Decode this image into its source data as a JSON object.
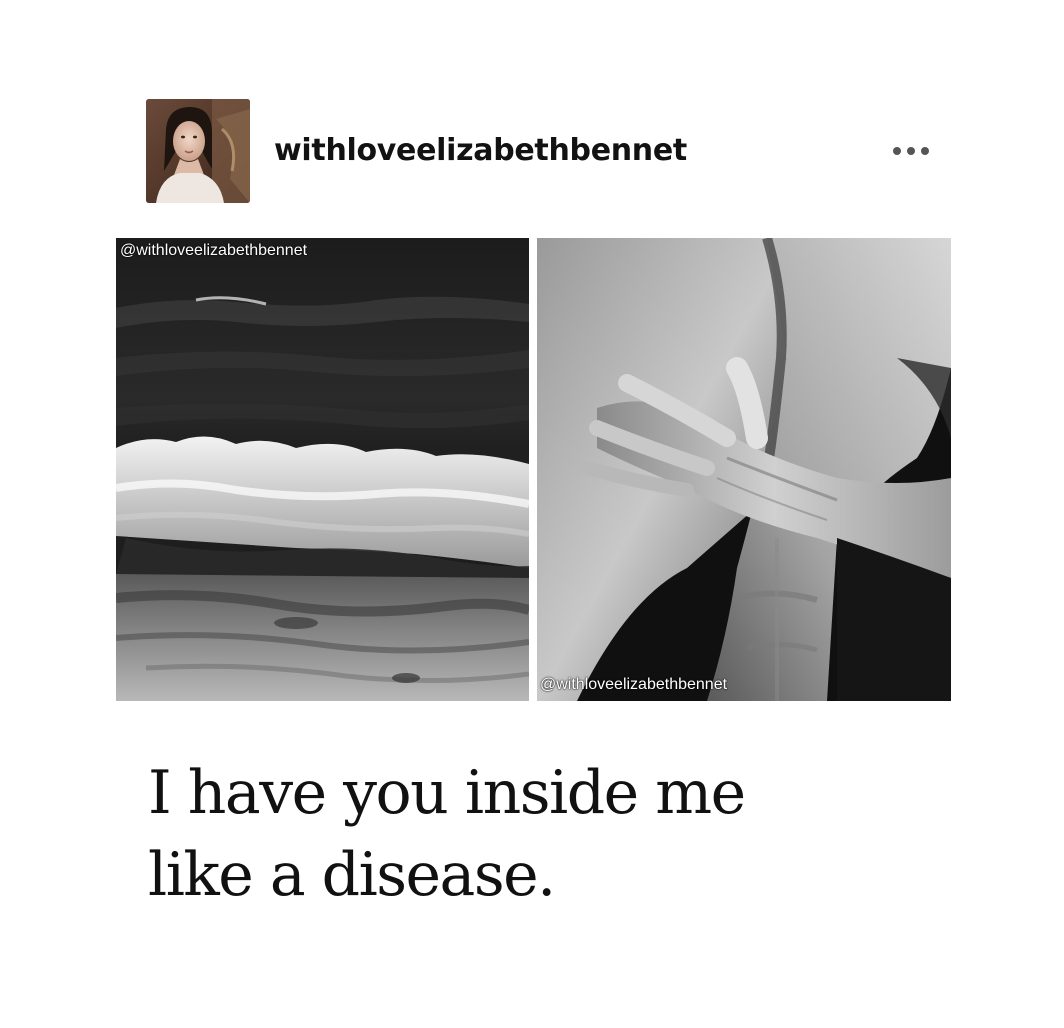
{
  "post": {
    "author": {
      "username": "withloveelizabethbennet",
      "avatar_icon": "portrait-avatar"
    },
    "menu": {
      "icon": "more-options-icon"
    },
    "photos": [
      {
        "subject": "ocean-waves",
        "watermark": "@withloveelizabethbennet",
        "watermark_position": "top-left"
      },
      {
        "subject": "embrace",
        "watermark": "@withloveelizabethbennet",
        "watermark_position": "bottom-left"
      }
    ],
    "caption": {
      "lines": [
        "I have you inside me",
        "like a disease."
      ]
    },
    "colors": {
      "background": "#ffffff",
      "text": "#121212",
      "icon": "#555555"
    }
  }
}
